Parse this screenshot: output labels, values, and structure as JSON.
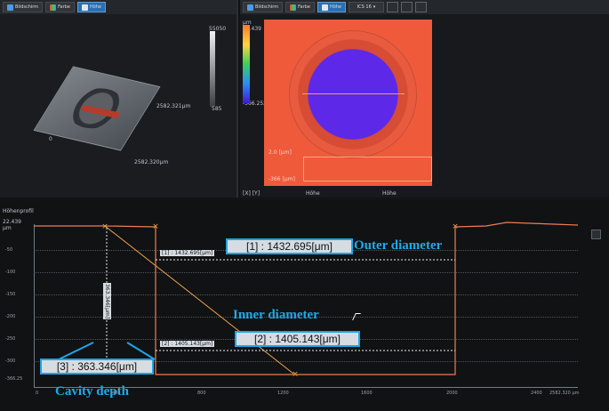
{
  "left_panel": {
    "toolbar": [
      "Bildschirm",
      "Farbe",
      "Höhe"
    ],
    "scale_top": "55050",
    "scale_bottom": "585",
    "dimension_1": "2582.321μm",
    "dimension_2": "2582.320μm",
    "origin_label": "0"
  },
  "right_panel": {
    "toolbar": [
      "Bildschirm",
      "Farbe",
      "Höhe"
    ],
    "legend_max": "22.439",
    "legend_min": "-366.252",
    "legend_unit": "μm",
    "dropdown": "ICS 16",
    "mini_top": "2.0 [μm]",
    "mini_bottom": "-366 [μm]",
    "footer": [
      "[X] [Y]",
      "Höhe",
      "Höhe"
    ]
  },
  "bottom_panel": {
    "title": "Höhenprofil",
    "y_top": "22.439",
    "y_unit": "μm",
    "y_ticks": [
      "22.439",
      "-50",
      "-100",
      "-150",
      "-200",
      "-250",
      "-300",
      "-366.25"
    ],
    "x_ticks": [
      "0",
      "400",
      "800",
      "1200",
      "1600",
      "2000",
      "2400",
      "2582.320 μm"
    ],
    "measurement_1": "[1] : 1432.695[μm]",
    "measurement_2": "[2] : 1405.143[μm]",
    "measurement_3": "[3] : 363.346[μm]",
    "small_1": "[1] : 1432.695[μm]",
    "small_2": "[2] : 1405.143[μm]",
    "vertical_label": "363.346[μm]",
    "outer_label": "Outer diameter",
    "inner_label": "Inner diameter",
    "cavity_label": "Cavity depth"
  },
  "colors": {
    "accent": "#1ea5e8",
    "surface": "#ef5a3b",
    "cavity": "#5d28e8"
  }
}
